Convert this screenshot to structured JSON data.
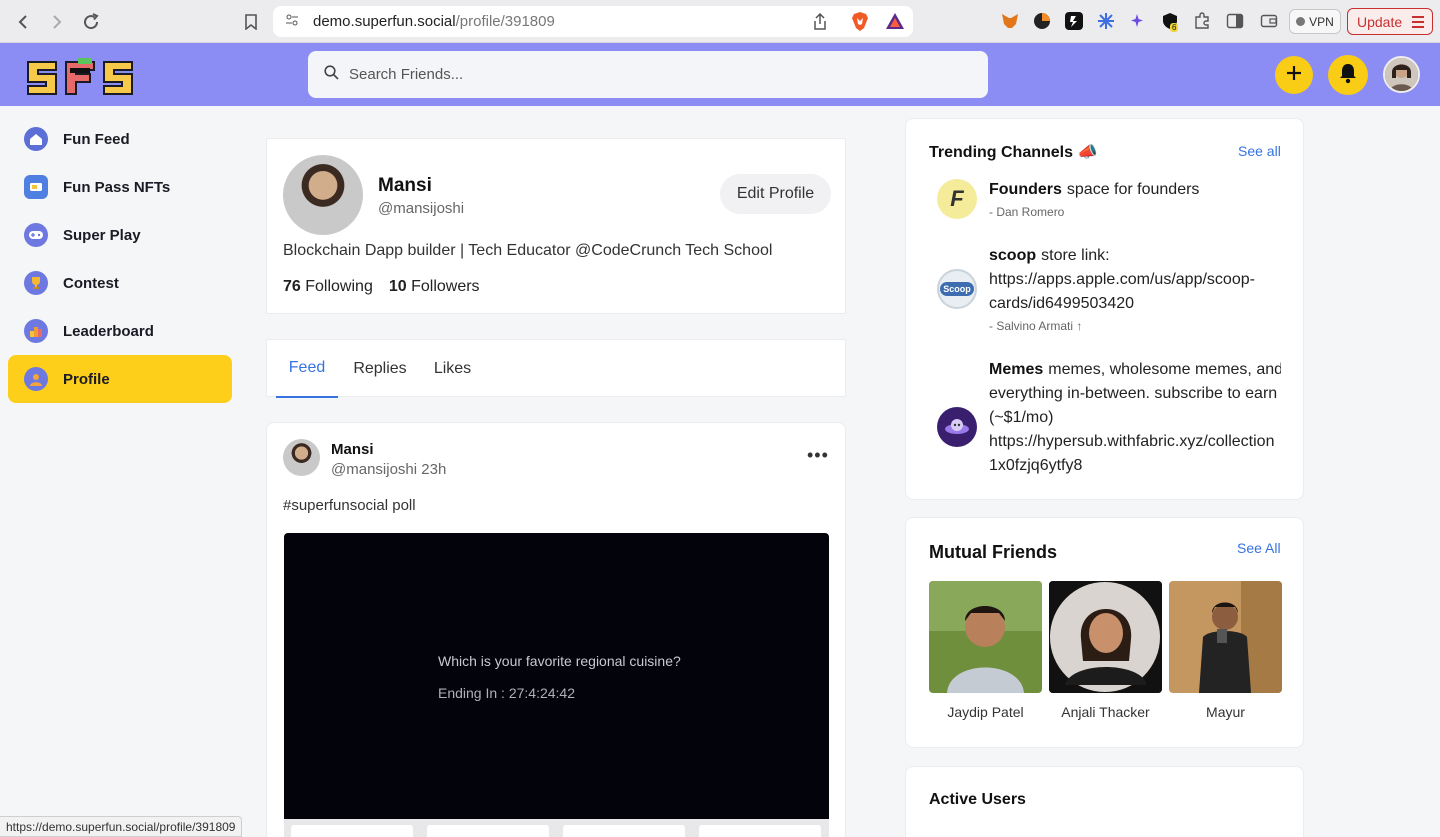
{
  "browser": {
    "url_host": "demo.superfun.social",
    "url_path": "/profile/391809",
    "vpn_label": "VPN",
    "update_label": "Update",
    "extension_badge": "6",
    "status_url": "https://demo.superfun.social/profile/391809"
  },
  "header": {
    "logo_text": "SFS",
    "search_placeholder": "Search Friends...",
    "create_icon": "plus-icon",
    "notification_icon": "bell-icon"
  },
  "sidebar": {
    "items": [
      {
        "label": "Fun Feed",
        "icon": "home-icon"
      },
      {
        "label": "Fun Pass NFTs",
        "icon": "nft-pass-icon"
      },
      {
        "label": "Super Play",
        "icon": "gamepad-icon"
      },
      {
        "label": "Contest",
        "icon": "trophy-icon"
      },
      {
        "label": "Leaderboard",
        "icon": "leaderboard-icon"
      },
      {
        "label": "Profile",
        "icon": "user-icon",
        "active": true
      }
    ]
  },
  "profile": {
    "name": "Mansi",
    "handle": "@mansijoshi",
    "edit_label": "Edit Profile",
    "bio": "Blockchain Dapp builder | Tech Educator @CodeCrunch Tech School",
    "following_count": "76",
    "following_label": "Following",
    "followers_count": "10",
    "followers_label": "Followers"
  },
  "tabs": [
    {
      "label": "Feed",
      "active": true
    },
    {
      "label": "Replies"
    },
    {
      "label": "Likes"
    }
  ],
  "post": {
    "author": "Mansi",
    "meta": "@mansijoshi 23h",
    "more": "•••",
    "text": "#superfunsocial poll",
    "poll_question": "Which is your favorite regional cuisine?",
    "poll_timer": "Ending In : 27:4:24:42"
  },
  "trending": {
    "title": "Trending Channels 📣",
    "see_all": "See all",
    "channels": [
      {
        "name": "Founders",
        "desc": "space for founders",
        "by": "- Dan Romero",
        "icon_text": "F"
      },
      {
        "name": "scoop",
        "desc_lines": [
          "store link:",
          "https://apps.apple.com/us/app/scoop-",
          "cards/id6499503420"
        ],
        "by": "- Salvino Armati ↑",
        "icon_text": "Scoop"
      },
      {
        "name": "Memes",
        "desc_lines": [
          "memes, wholesome memes, and",
          "everything in-between. subscribe to earn",
          "(~$1/mo)",
          "https://hypersub.withfabric.xyz/collection",
          "1x0fzjq6ytfy8"
        ]
      }
    ]
  },
  "mutual": {
    "title": "Mutual Friends",
    "see_all": "See All",
    "friends": [
      {
        "name": "Jaydip Patel"
      },
      {
        "name": "Anjali Thacker"
      },
      {
        "name": "Mayur"
      }
    ]
  },
  "active_users": {
    "title": "Active Users"
  },
  "colors": {
    "header_bg": "#8c8df4",
    "accent_yellow": "#fecf1a",
    "link_blue": "#3773e0"
  }
}
